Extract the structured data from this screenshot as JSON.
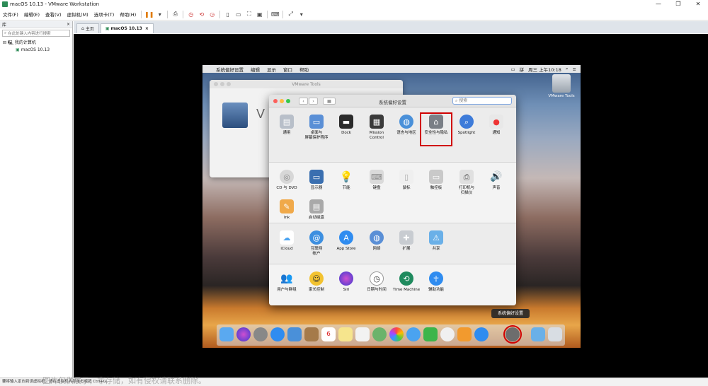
{
  "window": {
    "title": "macOS 10.13 - VMware Workstation"
  },
  "menu": [
    "文件(F)",
    "编辑(E)",
    "查看(V)",
    "虚拟机(M)",
    "选项卡(T)",
    "帮助(H)"
  ],
  "library": {
    "title": "库",
    "search_placeholder": "在此处键入内容进行搜索",
    "tree_root": "我的计算机",
    "tree_child": "macOS 10.13"
  },
  "tabs": [
    {
      "label": "主页"
    },
    {
      "label": "macOS 10.13"
    }
  ],
  "mac": {
    "menubar": {
      "app": "系统偏好设置",
      "items": [
        "编辑",
        "显示",
        "窗口",
        "帮助"
      ],
      "clock": "周三 上午10:18"
    },
    "vmtools_title": "VMware Tools",
    "desktop_icon_label": "VMware Tools",
    "prefs": {
      "title": "系统偏好设置",
      "search_placeholder": "搜索",
      "row1": [
        "通用",
        "桌面与\n屏幕保护程序",
        "Dock",
        "Mission\nControl",
        "语言与地区",
        "安全性与隐私",
        "Spotlight",
        "通知"
      ],
      "row2": [
        "CD 与 DVD",
        "显示器",
        "节能",
        "键盘",
        "鼠标",
        "触控板",
        "打印机与\n扫描仪",
        "声音"
      ],
      "row3": [
        "Ink",
        "启动磁盘"
      ],
      "row4": [
        "iCloud",
        "互联网\n帐户",
        "App Store",
        "网络",
        "扩展",
        "共享"
      ],
      "row5": [
        "用户与群组",
        "家长控制",
        "Siri",
        "日期与时间",
        "Time Machine",
        "辅助功能"
      ]
    },
    "dock_tooltip": "系统偏好设置"
  },
  "statusbar": "要将输入定向到该虚拟机，请在虚拟机内部单击或按 Ctrl+G。",
  "watermark": "图片仅供展示，非存储，如有侵权请联系删除。",
  "colors": {
    "highlight": "#d00000",
    "accent": "#3d7bd9"
  }
}
